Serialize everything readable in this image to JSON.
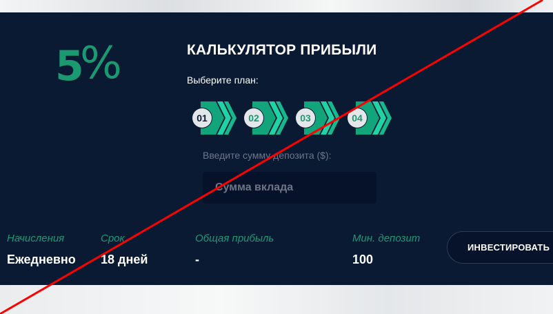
{
  "rate": {
    "digit": "5",
    "sign": "%"
  },
  "calculator": {
    "title": "КАЛЬКУЛЯТОР ПРИБЫЛИ",
    "choose_plan_label": "Выберите план:",
    "plans": [
      {
        "label": "01",
        "selected": true
      },
      {
        "label": "02",
        "selected": false
      },
      {
        "label": "03",
        "selected": false
      },
      {
        "label": "04",
        "selected": false
      }
    ],
    "deposit_label": "Введите сумму депозита ($):",
    "deposit_placeholder": "Сумма вклада",
    "deposit_value": ""
  },
  "stats": [
    {
      "label": "Начисления",
      "value": "Ежедневно"
    },
    {
      "label": "Срок",
      "value": "18 дней"
    },
    {
      "label": "Общая прибыль",
      "value": "-"
    },
    {
      "label": "Мин. депозит",
      "value": "100"
    }
  ],
  "invest_button": "ИНВЕСТИРОВАТЬ",
  "colors": {
    "panel": "#0b1a33",
    "accent_green": "#1b9a72",
    "chevron_light": "#1fd3a5",
    "input_bg": "#06122a",
    "overlay_line": "#ff0000"
  }
}
